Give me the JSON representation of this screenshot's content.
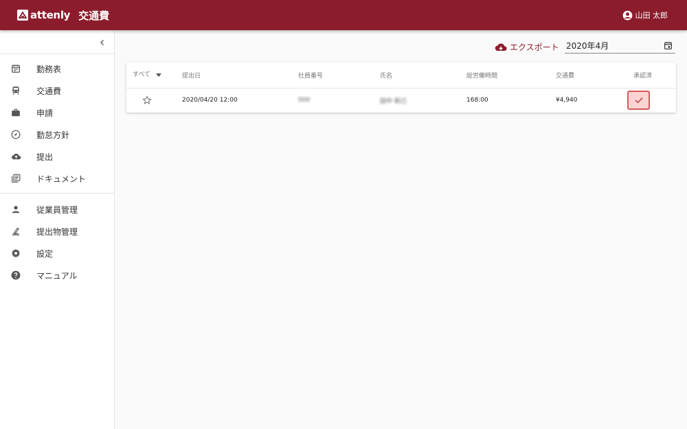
{
  "app": {
    "logo_text": "attenly",
    "title": "交通費",
    "user_name": "山田 太郎"
  },
  "sidebar": {
    "collapse_icon": "chevron-left-icon",
    "primary": [
      {
        "label": "勤務表",
        "icon": "calendar-icon"
      },
      {
        "label": "交通費",
        "icon": "train-icon"
      },
      {
        "label": "申請",
        "icon": "briefcase-icon"
      },
      {
        "label": "勤怠方針",
        "icon": "compass-icon"
      },
      {
        "label": "提出",
        "icon": "cloud-upload-icon"
      },
      {
        "label": "ドキュメント",
        "icon": "library-books-icon"
      }
    ],
    "secondary": [
      {
        "label": "従業員管理",
        "icon": "person-icon"
      },
      {
        "label": "提出物管理",
        "icon": "inbox-edit-icon"
      },
      {
        "label": "設定",
        "icon": "gear-icon"
      },
      {
        "label": "マニュアル",
        "icon": "help-icon"
      }
    ]
  },
  "toolbar": {
    "export_label": "エクスポート",
    "month_value": "2020年4月"
  },
  "table": {
    "filter_label": "すべて",
    "columns": [
      "提出日",
      "社員番号",
      "氏名",
      "総労働時間",
      "交通費",
      "承認済"
    ],
    "rows": [
      {
        "starred": false,
        "submitted": "2020/04/20 12:00",
        "employee_no": "000",
        "name": "田中 和己",
        "total_hours": "168:00",
        "fare": "¥4,940",
        "approved": true
      }
    ]
  },
  "colors": {
    "brand": "#8b1c2c",
    "approved_border": "#d35b5b",
    "approved_fill": "#fbd3d3"
  }
}
